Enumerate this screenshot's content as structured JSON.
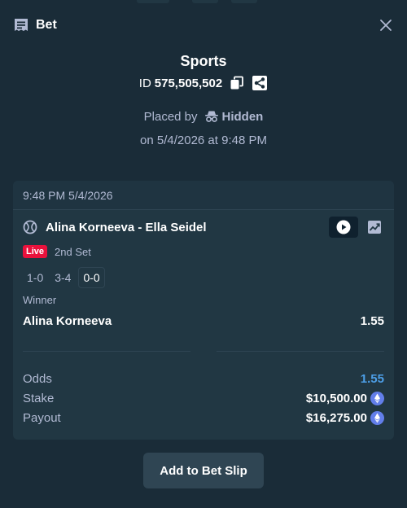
{
  "header": {
    "title": "Bet",
    "icons": {
      "bet": "bet-slip-icon",
      "close": "close-icon"
    }
  },
  "summary": {
    "sport": "Sports",
    "id_prefix": "ID",
    "id_number": "575,505,502",
    "placed_by_label": "Placed by",
    "placed_by_user": "Hidden",
    "placed_on": "on 5/4/2026 at 9:48 PM"
  },
  "card": {
    "timestamp": "9:48 PM 5/4/2026",
    "match": "Alina Korneeva - Ella Seidel",
    "live_badge": "Live",
    "period": "2nd Set",
    "scores": [
      "1-0",
      "3-4",
      "0-0"
    ],
    "market": "Winner",
    "selection": "Alina Korneeva",
    "selection_odds": "1.55",
    "totals": {
      "odds_label": "Odds",
      "odds_value": "1.55",
      "stake_label": "Stake",
      "stake_value": "$10,500.00",
      "payout_label": "Payout",
      "payout_value": "$16,275.00"
    }
  },
  "actions": {
    "add_to_slip": "Add to Bet Slip"
  },
  "colors": {
    "background": "#1a2c38",
    "card": "#213743",
    "text_muted": "#b1bad3",
    "live_red": "#e9113c",
    "odds_blue": "#4d9fe8",
    "button": "#2f4553",
    "eth_purple": "#627eea"
  }
}
